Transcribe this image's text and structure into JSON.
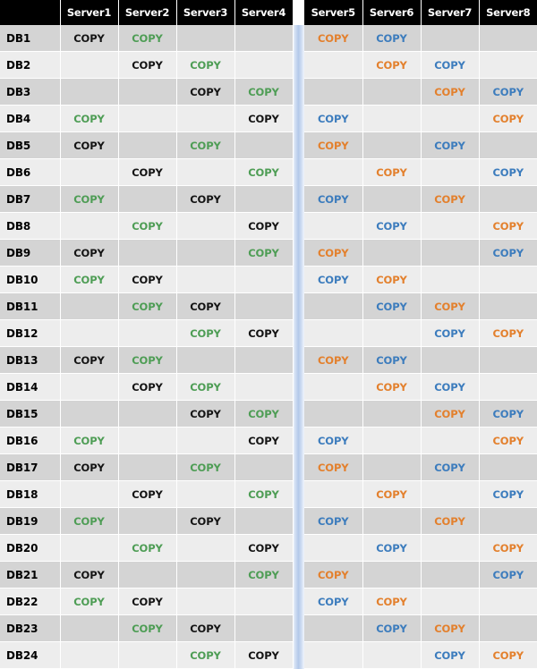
{
  "table": {
    "row_header_label": "",
    "copy_label": "COPY",
    "columns": [
      "Server1",
      "Server2",
      "Server3",
      "Server4",
      "Server5",
      "Server6",
      "Server7",
      "Server8"
    ],
    "separator_after_column_index": 3,
    "colors": {
      "primary": "#141414",
      "green": "#4e9d55",
      "orange": "#e3802d",
      "blue": "#3c7cbd",
      "header_background": "#000000",
      "header_text": "#ffffff",
      "row_odd_background": "#d4d4d4",
      "row_even_background": "#ededed",
      "separator_gradient_light": "#eef3fb",
      "separator_gradient_dark": "#b3c9e9",
      "gridline": "#ffffff"
    },
    "copy_types": [
      "primary",
      "green",
      "orange",
      "blue"
    ],
    "rows": [
      {
        "label": "DB1",
        "cells": [
          "primary",
          "green",
          "",
          "",
          "orange",
          "blue",
          "",
          ""
        ]
      },
      {
        "label": "DB2",
        "cells": [
          "",
          "primary",
          "green",
          "",
          "",
          "orange",
          "blue",
          ""
        ]
      },
      {
        "label": "DB3",
        "cells": [
          "",
          "",
          "primary",
          "green",
          "",
          "",
          "orange",
          "blue"
        ]
      },
      {
        "label": "DB4",
        "cells": [
          "green",
          "",
          "",
          "primary",
          "blue",
          "",
          "",
          "orange"
        ]
      },
      {
        "label": "DB5",
        "cells": [
          "primary",
          "",
          "green",
          "",
          "orange",
          "",
          "blue",
          ""
        ]
      },
      {
        "label": "DB6",
        "cells": [
          "",
          "primary",
          "",
          "green",
          "",
          "orange",
          "",
          "blue"
        ]
      },
      {
        "label": "DB7",
        "cells": [
          "green",
          "",
          "primary",
          "",
          "blue",
          "",
          "orange",
          ""
        ]
      },
      {
        "label": "DB8",
        "cells": [
          "",
          "green",
          "",
          "primary",
          "",
          "blue",
          "",
          "orange"
        ]
      },
      {
        "label": "DB9",
        "cells": [
          "primary",
          "",
          "",
          "green",
          "orange",
          "",
          "",
          "blue"
        ]
      },
      {
        "label": "DB10",
        "cells": [
          "green",
          "primary",
          "",
          "",
          "blue",
          "orange",
          "",
          ""
        ]
      },
      {
        "label": "DB11",
        "cells": [
          "",
          "green",
          "primary",
          "",
          "",
          "blue",
          "orange",
          ""
        ]
      },
      {
        "label": "DB12",
        "cells": [
          "",
          "",
          "green",
          "primary",
          "",
          "",
          "blue",
          "orange"
        ]
      },
      {
        "label": "DB13",
        "cells": [
          "primary",
          "green",
          "",
          "",
          "orange",
          "blue",
          "",
          ""
        ]
      },
      {
        "label": "DB14",
        "cells": [
          "",
          "primary",
          "green",
          "",
          "",
          "orange",
          "blue",
          ""
        ]
      },
      {
        "label": "DB15",
        "cells": [
          "",
          "",
          "primary",
          "green",
          "",
          "",
          "orange",
          "blue"
        ]
      },
      {
        "label": "DB16",
        "cells": [
          "green",
          "",
          "",
          "primary",
          "blue",
          "",
          "",
          "orange"
        ]
      },
      {
        "label": "DB17",
        "cells": [
          "primary",
          "",
          "green",
          "",
          "orange",
          "",
          "blue",
          ""
        ]
      },
      {
        "label": "DB18",
        "cells": [
          "",
          "primary",
          "",
          "green",
          "",
          "orange",
          "",
          "blue"
        ]
      },
      {
        "label": "DB19",
        "cells": [
          "green",
          "",
          "primary",
          "",
          "blue",
          "",
          "orange",
          ""
        ]
      },
      {
        "label": "DB20",
        "cells": [
          "",
          "green",
          "",
          "primary",
          "",
          "blue",
          "",
          "orange"
        ]
      },
      {
        "label": "DB21",
        "cells": [
          "primary",
          "",
          "",
          "green",
          "orange",
          "",
          "",
          "blue"
        ]
      },
      {
        "label": "DB22",
        "cells": [
          "green",
          "primary",
          "",
          "",
          "blue",
          "orange",
          "",
          ""
        ]
      },
      {
        "label": "DB23",
        "cells": [
          "",
          "green",
          "primary",
          "",
          "",
          "blue",
          "orange",
          ""
        ]
      },
      {
        "label": "DB24",
        "cells": [
          "",
          "",
          "green",
          "primary",
          "",
          "",
          "blue",
          "orange"
        ]
      }
    ]
  }
}
